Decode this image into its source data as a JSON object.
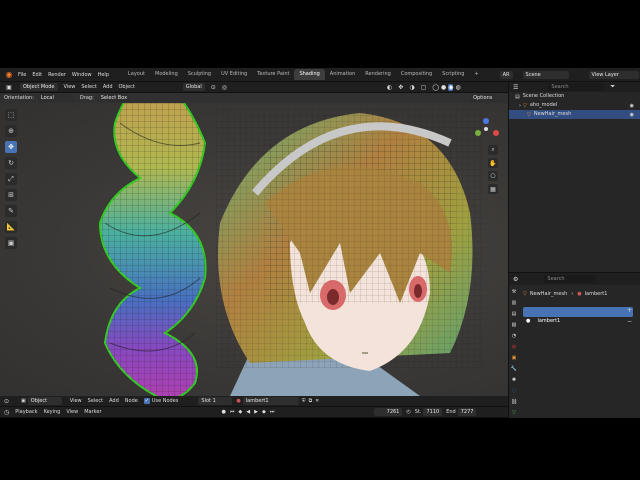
{
  "topbar": {
    "menus": [
      "File",
      "Edit",
      "Render",
      "Window",
      "Help"
    ],
    "tabs": [
      "Layout",
      "Modeling",
      "Sculpting",
      "UV Editing",
      "Texture Paint",
      "Shading",
      "Animation",
      "Rendering",
      "Compositing",
      "Scripting"
    ],
    "active_tab": "Shading",
    "scene_label": "Scene",
    "view_layer_label": "View Layer",
    "ar_label": "AR"
  },
  "header": {
    "mode": "Object Mode",
    "menus": [
      "View",
      "Select",
      "Add",
      "Object"
    ],
    "transform_space": "Global",
    "orientation_label": "Orientation:",
    "orientation_value": "Local",
    "drag_label": "Drag:",
    "drag_value": "Select Box",
    "options_label": "Options",
    "search_placeholder": "Search"
  },
  "outliner": {
    "collection": "Scene Collection",
    "items": [
      {
        "name": "aho_model"
      },
      {
        "name": "NewHair_mesh"
      }
    ]
  },
  "properties": {
    "search_placeholder": "Search",
    "breadcrumb_object": "NewHair_mesh",
    "breadcrumb_material": "lambert1",
    "material_slot": "lambert1"
  },
  "node_editor_header": {
    "type": "Object",
    "menus": [
      "View",
      "Select",
      "Add",
      "Node"
    ],
    "use_nodes_label": "Use Nodes",
    "slot_label": "Slot 1",
    "material_name": "lambert1"
  },
  "timeline": {
    "menus": [
      "Playback",
      "Keying",
      "View",
      "Marker"
    ],
    "current_frame": "7261",
    "start_label": "St.",
    "start_value": "7110",
    "end_label": "End",
    "end_value": "7277"
  },
  "colors": {
    "accent": "#4772b3",
    "selection_outline": "#33cc22",
    "viewport_bg": "#3d3d3d"
  }
}
